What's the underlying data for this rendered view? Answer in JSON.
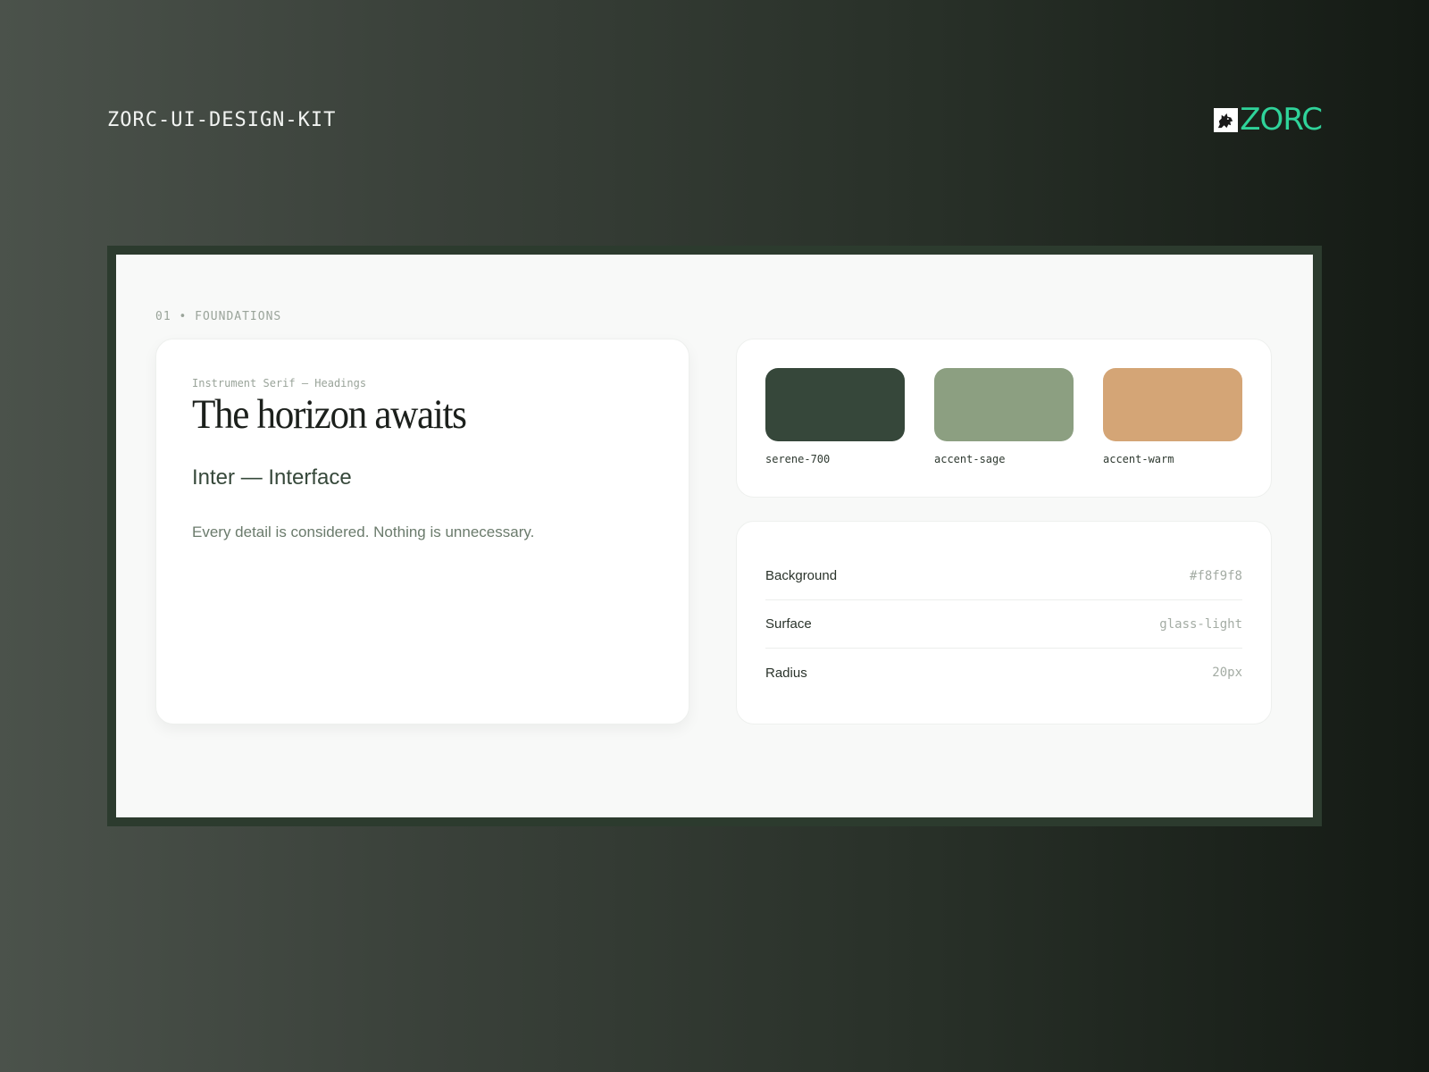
{
  "header": {
    "title": "ZORC-UI-DESIGN-KIT",
    "brand": {
      "name": "ZORC",
      "icon": "wolf-logo-icon",
      "color": "#2fd39a"
    }
  },
  "board": {
    "section_label": "01 • FOUNDATIONS",
    "typography": {
      "caption": "Instrument Serif — Headings",
      "heading": "The horizon awaits",
      "interface_label": "Inter — Interface",
      "body_text": "Every detail is considered. Nothing is unnecessary."
    },
    "colors": [
      {
        "name": "serene-700",
        "hex": "#36473a"
      },
      {
        "name": "accent-sage",
        "hex": "#8c9f81"
      },
      {
        "name": "accent-warm",
        "hex": "#d4a576"
      }
    ],
    "tokens": [
      {
        "label": "Background",
        "value": "#f8f9f8"
      },
      {
        "label": "Surface",
        "value": "glass-light"
      },
      {
        "label": "Radius",
        "value": "20px"
      }
    ]
  }
}
